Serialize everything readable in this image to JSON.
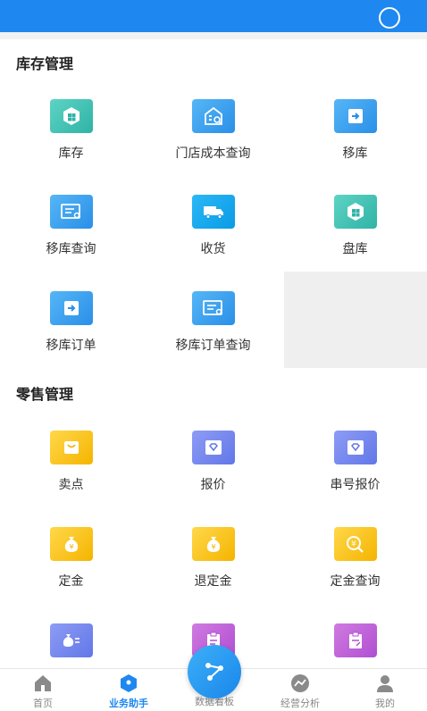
{
  "sections": {
    "inventory": {
      "title": "库存管理",
      "items": [
        {
          "label": "库存"
        },
        {
          "label": "门店成本查询"
        },
        {
          "label": "移库"
        },
        {
          "label": "移库查询"
        },
        {
          "label": "收货"
        },
        {
          "label": "盘库"
        },
        {
          "label": "移库订单"
        },
        {
          "label": "移库订单查询"
        }
      ]
    },
    "retail": {
      "title": "零售管理",
      "items": [
        {
          "label": "卖点"
        },
        {
          "label": "报价"
        },
        {
          "label": "串号报价"
        },
        {
          "label": "定金"
        },
        {
          "label": "退定金"
        },
        {
          "label": "定金查询"
        }
      ]
    }
  },
  "tabbar": {
    "tabs": [
      {
        "label": "首页",
        "icon": "home-icon"
      },
      {
        "label": "业务助手",
        "icon": "tag-icon",
        "active": true
      },
      {
        "label": "数据看板",
        "icon": "share-icon"
      },
      {
        "label": "经营分析",
        "icon": "trend-icon"
      },
      {
        "label": "我的",
        "icon": "user-icon"
      }
    ]
  },
  "colors": {
    "primary": "#1e88f0",
    "teal": "#2fb3a6",
    "yellow": "#f5b400",
    "indigo": "#6277e8",
    "purple": "#b04fd2"
  }
}
